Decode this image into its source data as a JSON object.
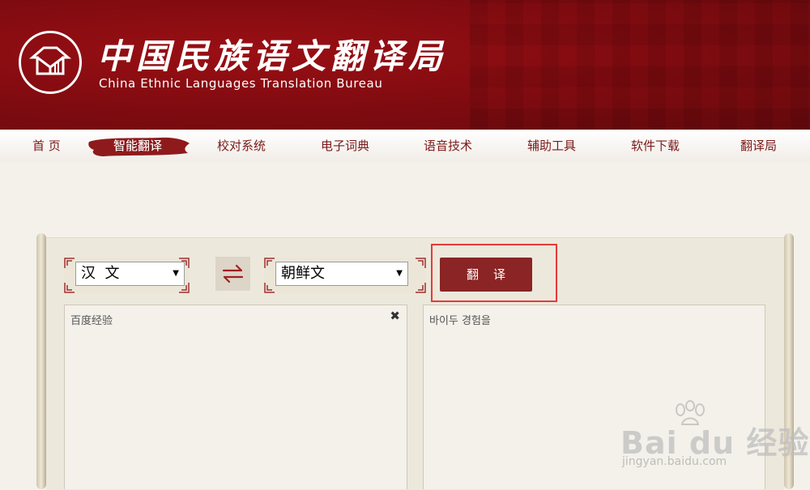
{
  "header": {
    "title_cn": "中国民族语文翻译局",
    "title_en": "China Ethnic Languages Translation Bureau"
  },
  "nav": {
    "items": [
      {
        "label": "首  页"
      },
      {
        "label": "智能翻译",
        "active": true
      },
      {
        "label": "校对系统"
      },
      {
        "label": "电子词典"
      },
      {
        "label": "语音技术"
      },
      {
        "label": "辅助工具"
      },
      {
        "label": "软件下载"
      },
      {
        "label": "翻译局"
      }
    ]
  },
  "translator": {
    "source_lang": "汉  文",
    "target_lang": "朝鲜文",
    "translate_label": "翻译",
    "source_text": "百度经验",
    "target_text": "바이두 경험을"
  },
  "watermark": {
    "brand": "Bai du 经验",
    "url": "jingyan.baidu.com"
  },
  "colors": {
    "header_red": "#7e0b10",
    "button_red": "#8b2424",
    "highlight": "#e53a3a"
  }
}
